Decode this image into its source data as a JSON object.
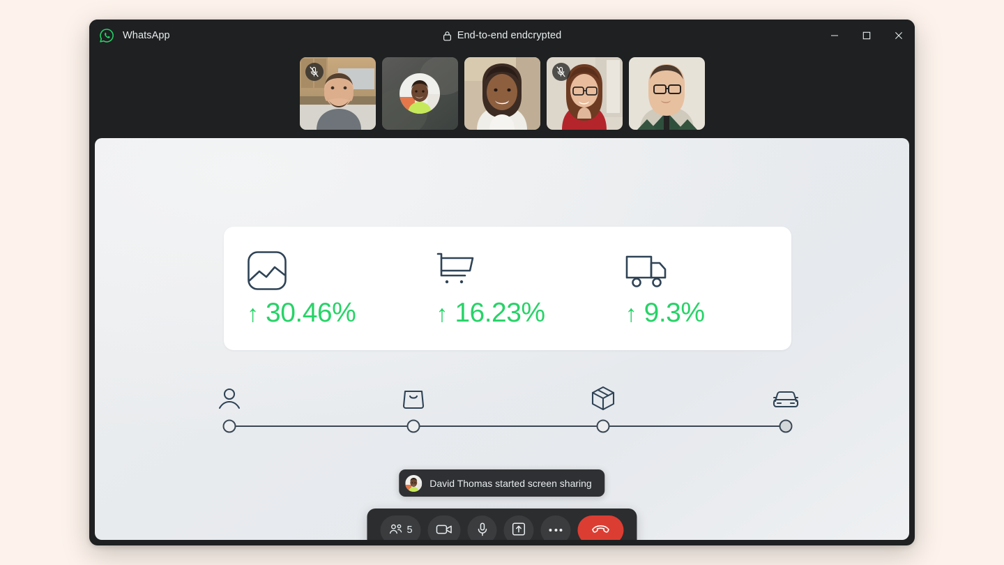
{
  "window": {
    "app_name": "WhatsApp",
    "logo_icon": "whatsapp-logo-icon",
    "encryption_text": "End-to-end endcrypted",
    "lock_icon": "lock-icon",
    "minimize_label": "Minimize",
    "maximize_label": "Maximize",
    "close_label": "Close",
    "brand_color": "#25D366"
  },
  "filmstrip": {
    "tiles": [
      {
        "id": "tile-1",
        "camera_on": true,
        "muted": true,
        "mic_icon": "mic-off-icon"
      },
      {
        "id": "tile-2",
        "camera_on": false,
        "muted": false,
        "avatar_icon": "avatar-icon"
      },
      {
        "id": "tile-3",
        "camera_on": true,
        "muted": false
      },
      {
        "id": "tile-4",
        "camera_on": true,
        "muted": true,
        "mic_icon": "mic-off-icon"
      },
      {
        "id": "tile-5",
        "camera_on": true,
        "muted": false
      }
    ]
  },
  "screen_share": {
    "metrics": [
      {
        "icon": "chart-frame-icon",
        "arrow": "↑",
        "value": "30.46%",
        "direction": "up"
      },
      {
        "icon": "shopping-cart-icon",
        "arrow": "↑",
        "value": "16.23%",
        "direction": "up"
      },
      {
        "icon": "delivery-truck-icon",
        "arrow": "↑",
        "value": "9.3%",
        "direction": "up"
      }
    ],
    "positive_color": "#27D367",
    "timeline": {
      "steps": [
        {
          "icon": "person-icon",
          "filled": false,
          "position": 0
        },
        {
          "icon": "shopping-bag-icon",
          "filled": false,
          "position": 33.4
        },
        {
          "icon": "package-box-icon",
          "filled": false,
          "position": 66.8
        },
        {
          "icon": "car-icon",
          "filled": true,
          "position": 100
        }
      ]
    }
  },
  "toast": {
    "avatar_icon": "avatar-icon",
    "message": "David Thomas started screen sharing"
  },
  "controls": {
    "participants": {
      "icon": "people-icon",
      "count": "5",
      "label": "Participants"
    },
    "camera": {
      "icon": "video-camera-icon",
      "label": "Camera"
    },
    "microphone": {
      "icon": "microphone-icon",
      "label": "Microphone"
    },
    "share_screen": {
      "icon": "share-screen-icon",
      "label": "Share screen"
    },
    "more": {
      "icon": "more-options-icon",
      "label": "More options"
    },
    "end_call": {
      "icon": "end-call-icon",
      "label": "End call",
      "color": "#DC3D32"
    }
  }
}
